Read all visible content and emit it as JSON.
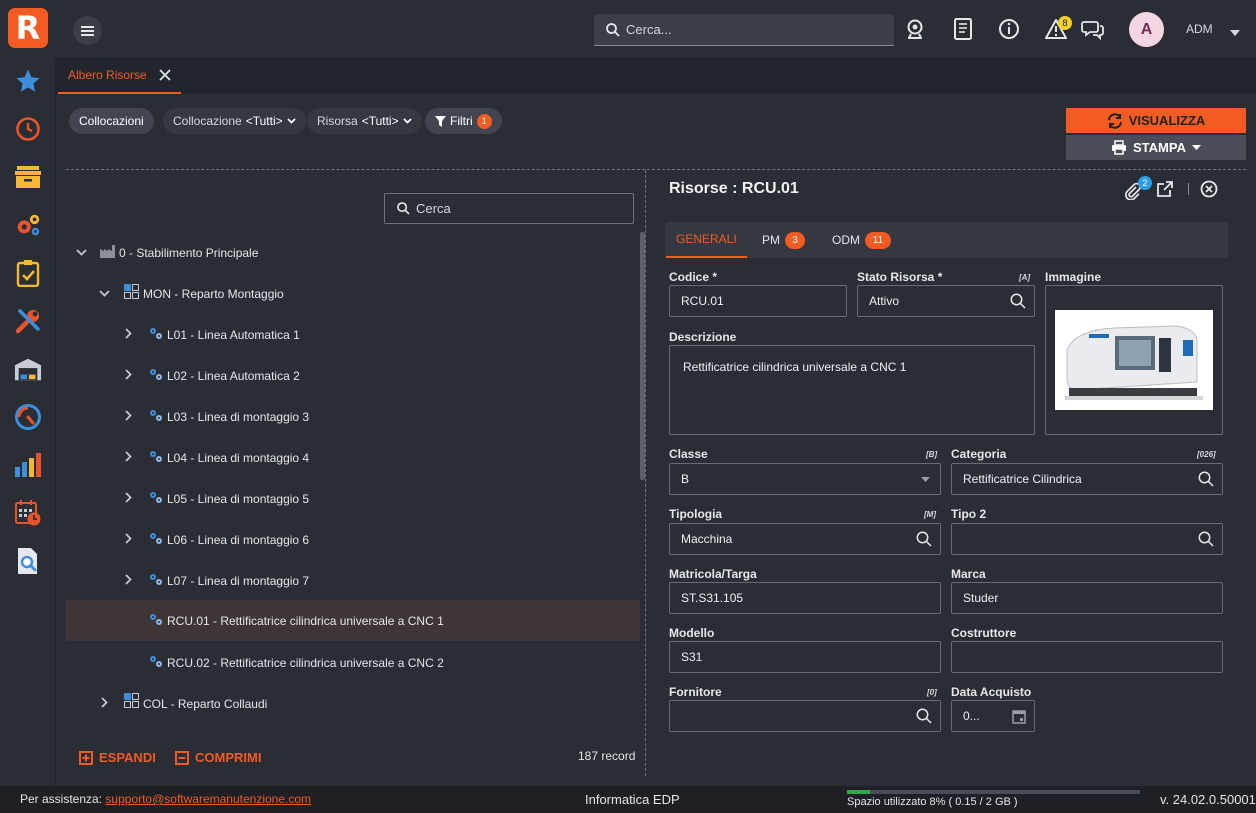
{
  "app": {
    "logo_letter": "R"
  },
  "header": {
    "search_placeholder": "Cerca...",
    "notification_count": "8",
    "avatar_letter": "A",
    "user": "ADM"
  },
  "tab": {
    "label": "Albero Risorse"
  },
  "filters": {
    "collocazioni": "Collocazioni",
    "collocazione": "Collocazione",
    "collocazione_value": "<Tutti>",
    "risorsa": "Risorsa",
    "risorsa_value": "<Tutti>",
    "filtri": "Filtri",
    "filtri_count": "1"
  },
  "actions": {
    "visualizza": "VISUALIZZA",
    "stampa": "STAMPA"
  },
  "tree": {
    "search_placeholder": "Cerca",
    "rows": [
      {
        "label": "0 - Stabilimento Principale"
      },
      {
        "label": "MON - Reparto Montaggio"
      },
      {
        "label": "L01 - Linea Automatica 1"
      },
      {
        "label": "L02 - Linea Automatica 2"
      },
      {
        "label": "L03 - Linea di montaggio 3"
      },
      {
        "label": "L04 - Linea di montaggio 4"
      },
      {
        "label": "L05 - Linea di montaggio 5"
      },
      {
        "label": "L06 - Linea di montaggio 6"
      },
      {
        "label": "L07 - Linea di montaggio 7"
      },
      {
        "label": "RCU.01 - Rettificatrice cilindrica universale a CNC 1"
      },
      {
        "label": "RCU.02 - Rettificatrice cilindrica universale a CNC 2"
      },
      {
        "label": "COL - Reparto Collaudi"
      }
    ],
    "expand": "ESPANDI",
    "collapse": "COMPRIMI",
    "record_count": "187 record"
  },
  "detail": {
    "title": "Risorse : RCU.01",
    "attachments_count": "2",
    "tabs": [
      {
        "label": "GENERALI"
      },
      {
        "label": "PM",
        "count": "3"
      },
      {
        "label": "ODM",
        "count": "11"
      }
    ],
    "fields": {
      "codice_label": "Codice *",
      "codice": "RCU.01",
      "stato_label": "Stato Risorsa *",
      "stato_code": "[A]",
      "stato": "Attivo",
      "immagine_label": "Immagine",
      "descrizione_label": "Descrizione",
      "descrizione": "Rettificatrice cilindrica universale a CNC 1",
      "classe_label": "Classe",
      "classe_code": "[B]",
      "classe": "B",
      "categoria_label": "Categoria",
      "categoria_code": "[026]",
      "categoria": "Rettificatrice Cilindrica",
      "tipologia_label": "Tipologia",
      "tipologia_code": "[M]",
      "tipologia": "Macchina",
      "tipo2_label": "Tipo 2",
      "tipo2": "",
      "matricola_label": "Matricola/Targa",
      "matricola": "ST.S31.105",
      "marca_label": "Marca",
      "marca": "Studer",
      "modello_label": "Modello",
      "modello": "S31",
      "costruttore_label": "Costruttore",
      "costruttore": "",
      "fornitore_label": "Fornitore",
      "fornitore_code": "[0]",
      "fornitore": "",
      "data_acquisto_label": "Data Acquisto",
      "data_acquisto": "0..."
    }
  },
  "status": {
    "support_label": "Per assistenza:",
    "support_email": "supporto@softwaremanutenzione.com",
    "company": "Informatica EDP",
    "space_text": "Spazio utilizzato 8% ( 0.15 / 2 GB )",
    "space_used_percent": 8,
    "version": "v. 24.02.0.50001"
  },
  "colors": {
    "accent": "#f25b22",
    "sidebar_icon_blue": "#3b8fdc"
  }
}
